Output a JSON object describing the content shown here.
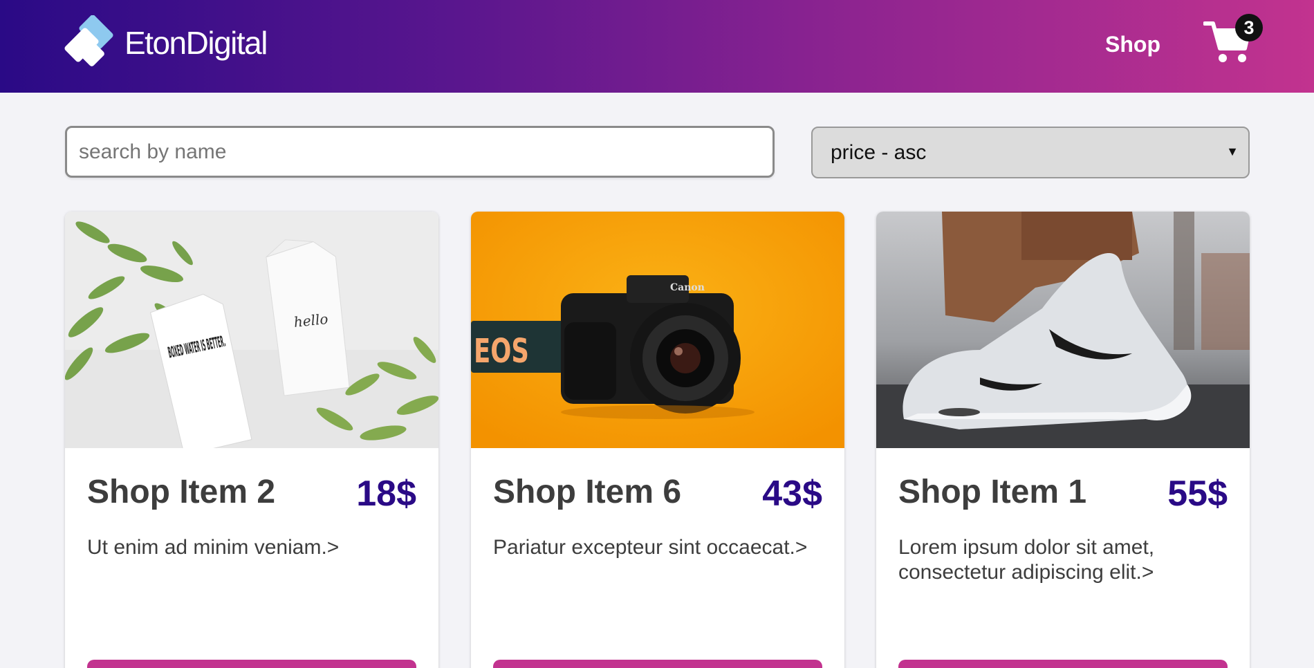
{
  "header": {
    "brand": "EtonDigital",
    "nav_shop": "Shop",
    "cart_count": "3"
  },
  "controls": {
    "search_placeholder": "search by name",
    "search_value": "",
    "sort_selected": "price - asc"
  },
  "products": [
    {
      "title": "Shop Item 2",
      "price": "18$",
      "description": "Ut enim ad minim veniam.>",
      "image": "boxed-water-cartons"
    },
    {
      "title": "Shop Item 6",
      "price": "43$",
      "description": "Pariatur excepteur sint occaecat.>",
      "image": "canon-camera"
    },
    {
      "title": "Shop Item 1",
      "price": "55$",
      "description": "Lorem ipsum dolor sit amet, consectetur adipiscing elit.>",
      "image": "white-sneaker"
    }
  ],
  "image_text": {
    "carton_print": "BOXED WATER IS BETTER.",
    "carton_script": "hello",
    "camera_brand": "Canon",
    "strap_text": "EOS"
  },
  "colors": {
    "header_gradient_start": "#2a0a86",
    "header_gradient_end": "#c2338f",
    "price_color": "#2a0a86",
    "button_color": "#c2338f",
    "page_bg": "#f3f3f7"
  }
}
